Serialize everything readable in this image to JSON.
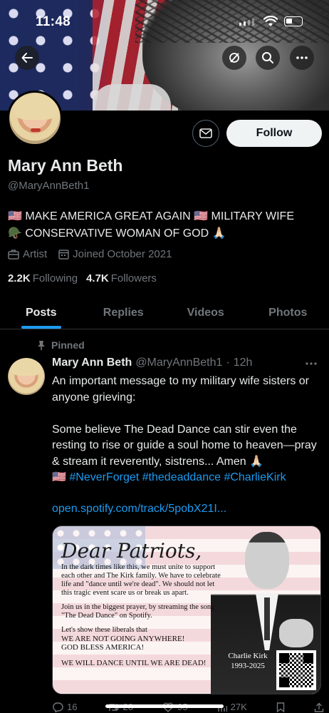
{
  "status_bar": {
    "time": "11:48"
  },
  "header": {
    "back_icon": "arrow-left-icon",
    "actions": [
      "circle-slash-icon",
      "search-icon",
      "more-icon"
    ]
  },
  "profile": {
    "display_name": "Mary Ann Beth",
    "handle": "@MaryAnnBeth1",
    "follow_label": "Follow",
    "bio_line1": "🇺🇸 MAKE AMERICA GREAT AGAIN 🇺🇸 MILITARY WIFE",
    "bio_line2": "🪖 CONSERVATIVE WOMAN OF GOD 🙏🏻",
    "category": "Artist",
    "joined": "Joined October 2021",
    "following_count": "2.2K",
    "following_label": "Following",
    "followers_count": "4.7K",
    "followers_label": "Followers"
  },
  "tabs": [
    {
      "label": "Posts",
      "active": true
    },
    {
      "label": "Replies",
      "active": false
    },
    {
      "label": "Videos",
      "active": false
    },
    {
      "label": "Photos",
      "active": false
    }
  ],
  "tweet": {
    "pinned_label": "Pinned",
    "author_name": "Mary Ann Beth",
    "author_handle": "@MaryAnnBeth1",
    "separator": "·",
    "time_ago": "12h",
    "text_p1": "An important message to my military wife sisters or anyone grieving:",
    "text_p2": "Some believe The Dead Dance can stir even the resting to rise or guide a soul home to heaven—pray & stream it reverently, sistrens... Amen 🙏🏻",
    "flag_emoji": "🇺🇸",
    "hashtags": [
      "#NeverForget",
      "#thedeaddance",
      "#CharlieKirk"
    ],
    "link": "open.spotify.com/track/5pobX21I...",
    "card": {
      "heading": "Dear Patriots,",
      "para1": "In the dark times like this, we must unite to support each other and The Kirk family. We have to celebrate life and \"dance until we're dead\". We should not let this tragic event scare us or break us apart.",
      "para2": "Join us in the biggest prayer, by streaming the song \"The Dead Dance\" on Spotify.",
      "para3": "Let's show these liberals that",
      "caps1": "WE ARE NOT GOING ANYWHERE!",
      "caps2": "GOD BLESS AMERICA!",
      "caps3": "WE WILL DANCE UNTIL WE ARE DEAD!",
      "caption_name": "Charlie Kirk",
      "caption_years": "1993-2025"
    },
    "actions": {
      "replies": "16",
      "reposts": "20",
      "likes": "95",
      "views": "27K"
    }
  },
  "colors": {
    "accent": "#1d9bf0",
    "background": "#000000",
    "secondary_text": "#71767b",
    "primary_text": "#e7e9ea"
  }
}
